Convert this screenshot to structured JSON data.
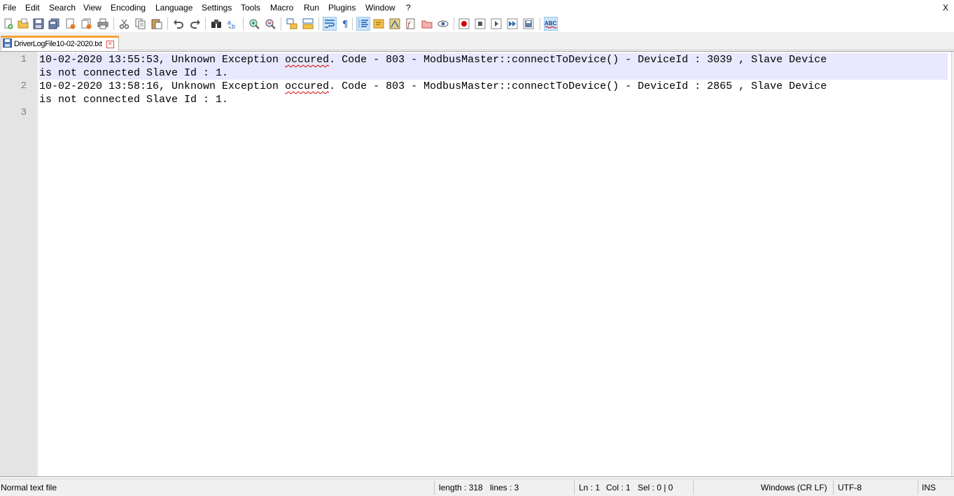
{
  "menu": [
    "File",
    "Edit",
    "Search",
    "View",
    "Encoding",
    "Language",
    "Settings",
    "Tools",
    "Macro",
    "Run",
    "Plugins",
    "Window",
    "?"
  ],
  "window_close": "X",
  "tab": {
    "label": "DriverLogFile10-02-2020.txt",
    "close_glyph": "✕"
  },
  "editor": {
    "line_numbers": [
      "1",
      "2",
      "3"
    ],
    "lines": [
      {
        "a": "10-02-2020 13:55:53,  Unknown Exception ",
        "misspelled": "occured",
        "b": ". Code - 803 - ModbusMaster::connectToDevice() - DeviceId : 3039 , Slave Device",
        "wrap": "is not connected Slave Id : 1."
      },
      {
        "a": "10-02-2020 13:58:16,  Unknown Exception ",
        "misspelled": "occured",
        "b": ". Code - 803 - ModbusMaster::connectToDevice() - DeviceId : 2865 , Slave Device",
        "wrap": "is not connected Slave Id : 1."
      }
    ]
  },
  "status": {
    "file_type": "Normal text file",
    "length": "length : 318",
    "lines": "lines : 3",
    "ln": "Ln : 1",
    "col": "Col : 1",
    "sel": "Sel : 0 | 0",
    "eol": "Windows (CR LF)",
    "encoding": "UTF-8",
    "mode": "INS"
  },
  "colors": {
    "current_line": "#e8e8ff",
    "gutter": "#e4e4e4",
    "line_number": "#808080",
    "tab_accent": "#fa9f2e",
    "spell_underline": "#d00000"
  }
}
